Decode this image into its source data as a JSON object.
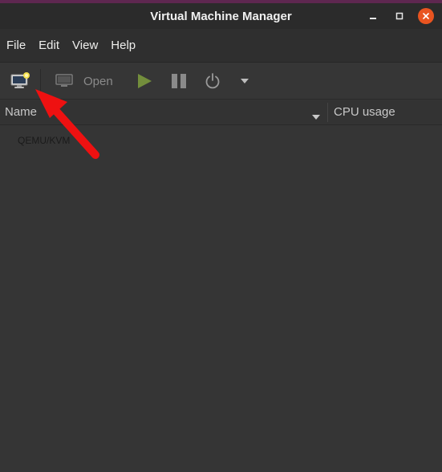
{
  "window": {
    "title": "Virtual Machine Manager",
    "accent": "#e95420"
  },
  "menubar": {
    "items": [
      "File",
      "Edit",
      "View",
      "Help"
    ]
  },
  "toolbar": {
    "new_vm_icon": "monitor-new-icon",
    "open_icon": "monitor-icon",
    "open_label": "Open",
    "run_icon": "play-icon",
    "pause_icon": "pause-icon",
    "shutdown_icon": "power-icon",
    "shutdown_menu_icon": "chevron-down-icon",
    "run_color": "#738e3c"
  },
  "list": {
    "columns": [
      "Name",
      "CPU usage"
    ],
    "connections": [
      "QEMU/KVM"
    ]
  },
  "annotation": {
    "arrow_color": "#ee1111"
  }
}
